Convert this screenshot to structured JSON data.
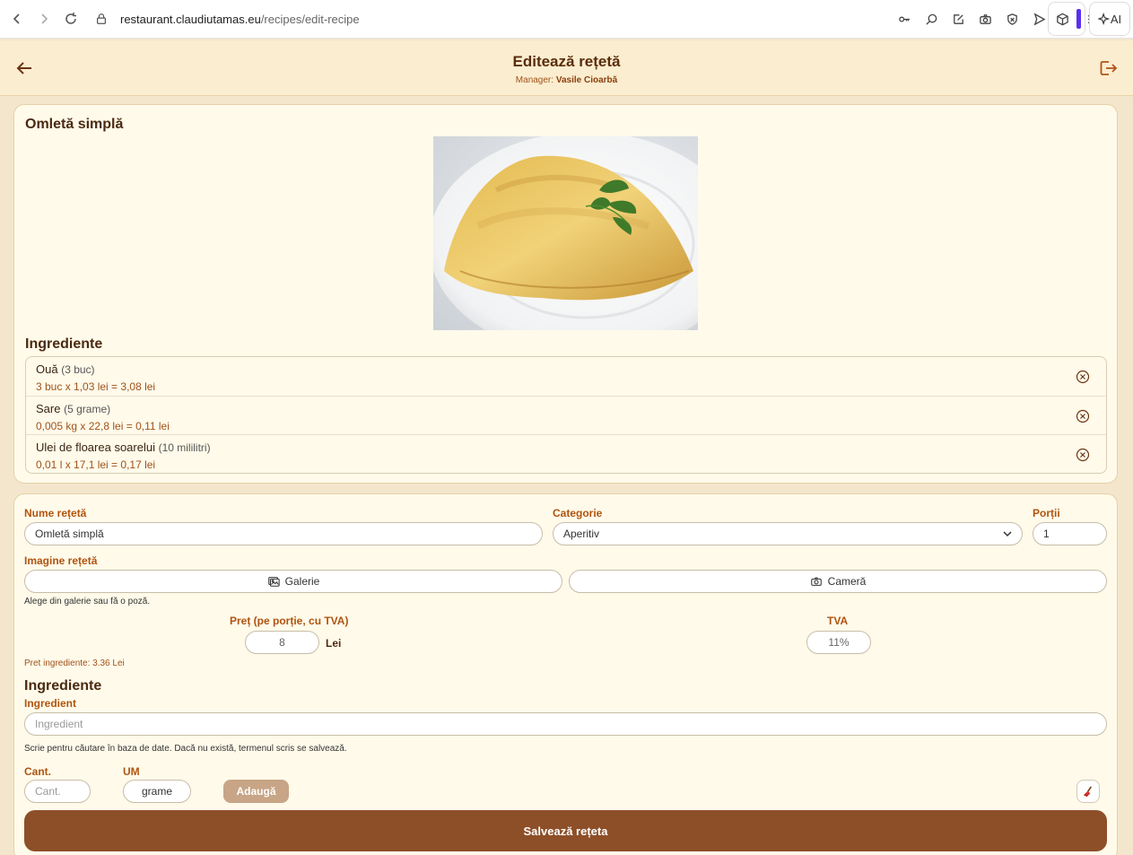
{
  "browser": {
    "url_host": "restaurant.claudiutamas.eu",
    "url_path": "/recipes/edit-recipe",
    "ai_label": "AI"
  },
  "header": {
    "title": "Editează rețetă",
    "manager_label": "Manager:",
    "manager_name": "Vasile Cioarbă"
  },
  "preview": {
    "recipe_name": "Omletă simplă",
    "ingredients_title": "Ingrediente",
    "ingredients": [
      {
        "name": "Ouă",
        "qty": "(3 buc)",
        "calc": "3 buc x 1,03 lei = 3,08 lei"
      },
      {
        "name": "Sare",
        "qty": "(5 grame)",
        "calc": "0,005 kg x 22,8 lei = 0,11 lei"
      },
      {
        "name": "Ulei de floarea soarelui",
        "qty": "(10 mililitri)",
        "calc": "0,01 l x 17,1 lei = 0,17 lei"
      }
    ]
  },
  "form": {
    "name_label": "Nume rețetă",
    "name_value": "Omletă simplă",
    "category_label": "Categorie",
    "category_value": "Aperitiv",
    "portions_label": "Porții",
    "portions_value": "1",
    "image_label": "Imagine rețetă",
    "gallery_button": "Galerie",
    "camera_button": "Cameră",
    "image_help": "Alege din galerie sau fă o poză.",
    "price_label": "Preț (pe porție, cu TVA)",
    "price_value": "8",
    "price_unit": "Lei",
    "vat_label": "TVA",
    "vat_value": "11%",
    "ingredients_price": "Pret ingrediente: 3.36 Lei",
    "ingredients_title": "Ingrediente",
    "ingredient_label": "Ingredient",
    "ingredient_placeholder": "Ingredient",
    "ingredient_help": "Scrie pentru căutare în baza de date. Dacă nu există, termenul scris se salvează.",
    "qty_label": "Cant.",
    "qty_placeholder": "Cant.",
    "unit_label": "UM",
    "unit_value": "grame",
    "add_button": "Adaugă",
    "save_button": "Salvează rețeta"
  },
  "colors": {
    "accent": "#b0540f",
    "primary_button": "#8d4f28",
    "background": "#fffaea",
    "header_bg": "#fbedcf"
  }
}
